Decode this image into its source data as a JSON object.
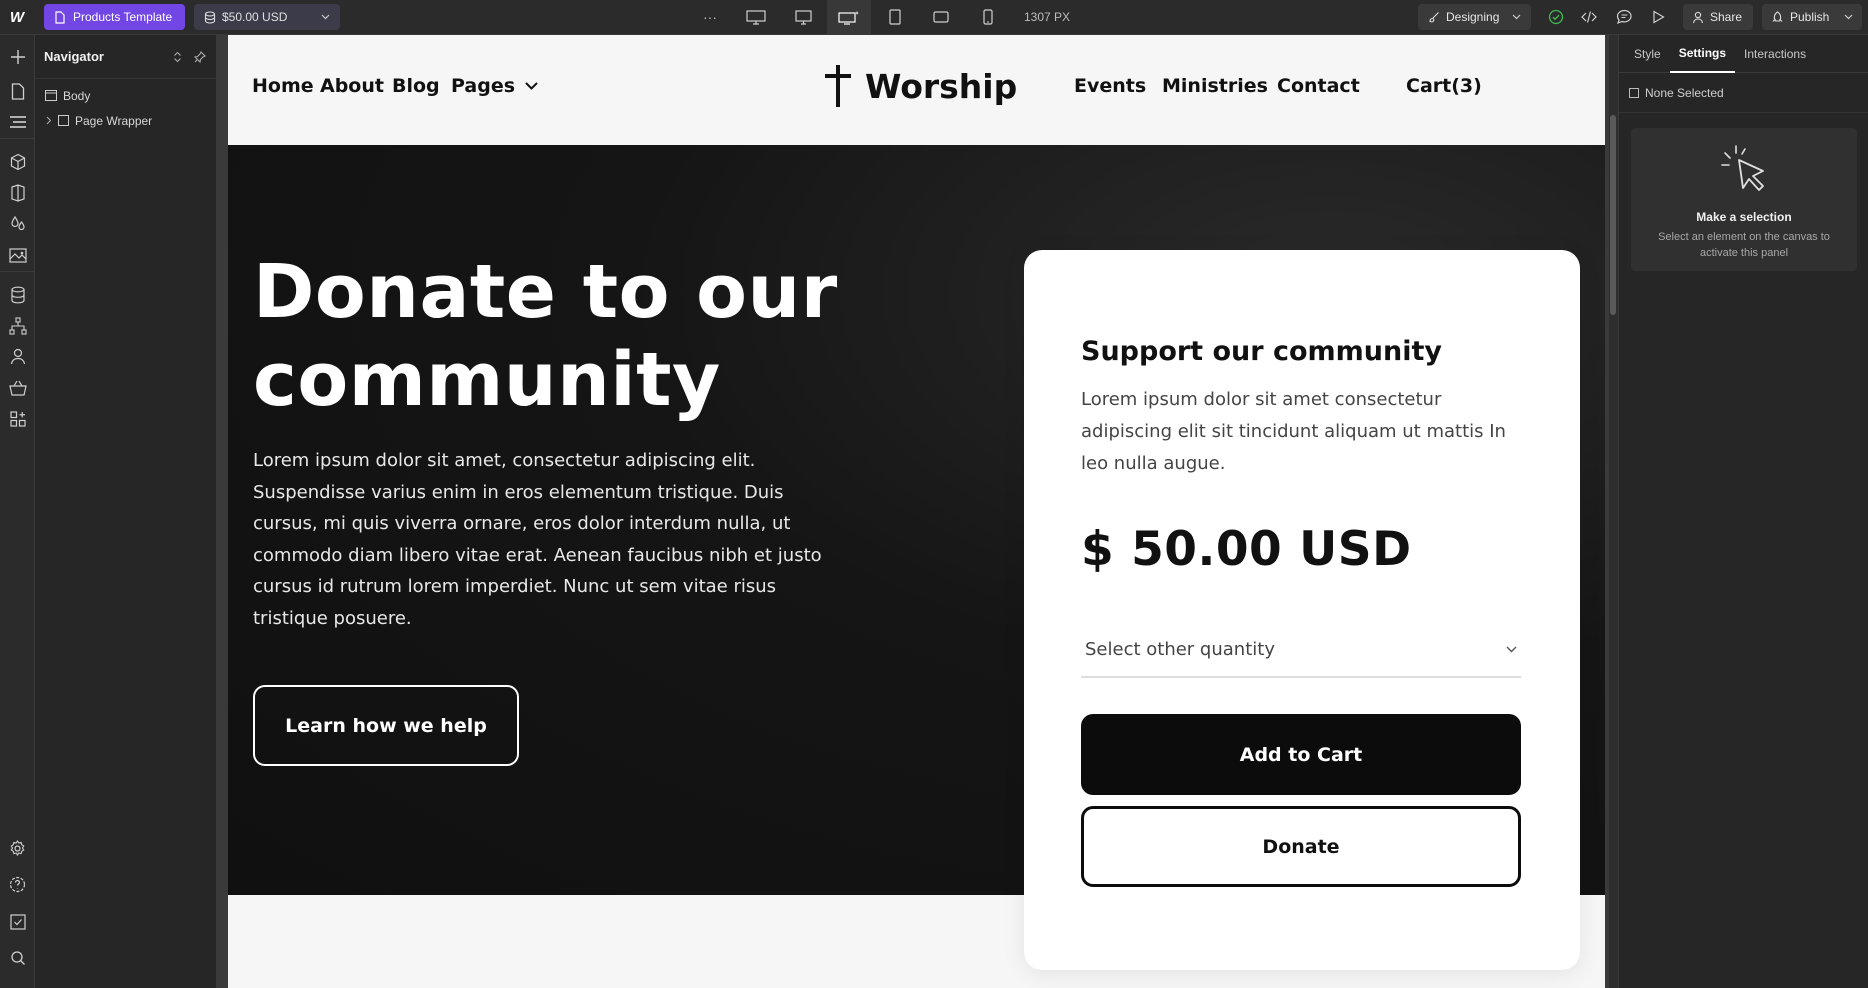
{
  "topbar": {
    "logo": "W",
    "page_name": "Products Template",
    "collection_item": "$50.00 USD",
    "more": "···",
    "width_readout": "1307 PX",
    "mode": "Designing",
    "share": "Share",
    "publish": "Publish"
  },
  "navigator": {
    "title": "Navigator",
    "rows": [
      "Body",
      "Page Wrapper"
    ]
  },
  "site": {
    "nav_left": [
      "Home",
      "About",
      "Blog",
      "Pages"
    ],
    "brand": "Worship",
    "nav_right": [
      "Events",
      "Ministries",
      "Contact",
      "Cart(3)"
    ]
  },
  "hero": {
    "title": "Donate to our community",
    "text": "Lorem ipsum dolor sit amet, consectetur adipiscing elit. Suspendisse varius enim in eros elementum tristique. Duis cursus, mi quis viverra ornare, eros dolor interdum nulla, ut commodo diam libero vitae erat. Aenean faucibus nibh et justo cursus id rutrum lorem imperdiet. Nunc ut sem vitae risus tristique posuere.",
    "button": "Learn how we help"
  },
  "card": {
    "title": "Support our community",
    "text": "Lorem ipsum dolor sit amet consectetur adipiscing elit sit tincidunt aliquam ut mattis In leo nulla augue.",
    "price": "$ 50.00 USD",
    "select_placeholder": "Select other quantity",
    "add_to_cart": "Add to Cart",
    "donate": "Donate"
  },
  "right_panel": {
    "tabs": [
      "Style",
      "Settings",
      "Interactions"
    ],
    "active_tab": "Settings",
    "none_selected": "None Selected",
    "empty_title": "Make a selection",
    "empty_text": "Select an element on the canvas to activate this panel"
  },
  "colors": {
    "accent_purple": "#7246e5",
    "status_green": "#3fb950",
    "hero_bg": "#121212"
  }
}
